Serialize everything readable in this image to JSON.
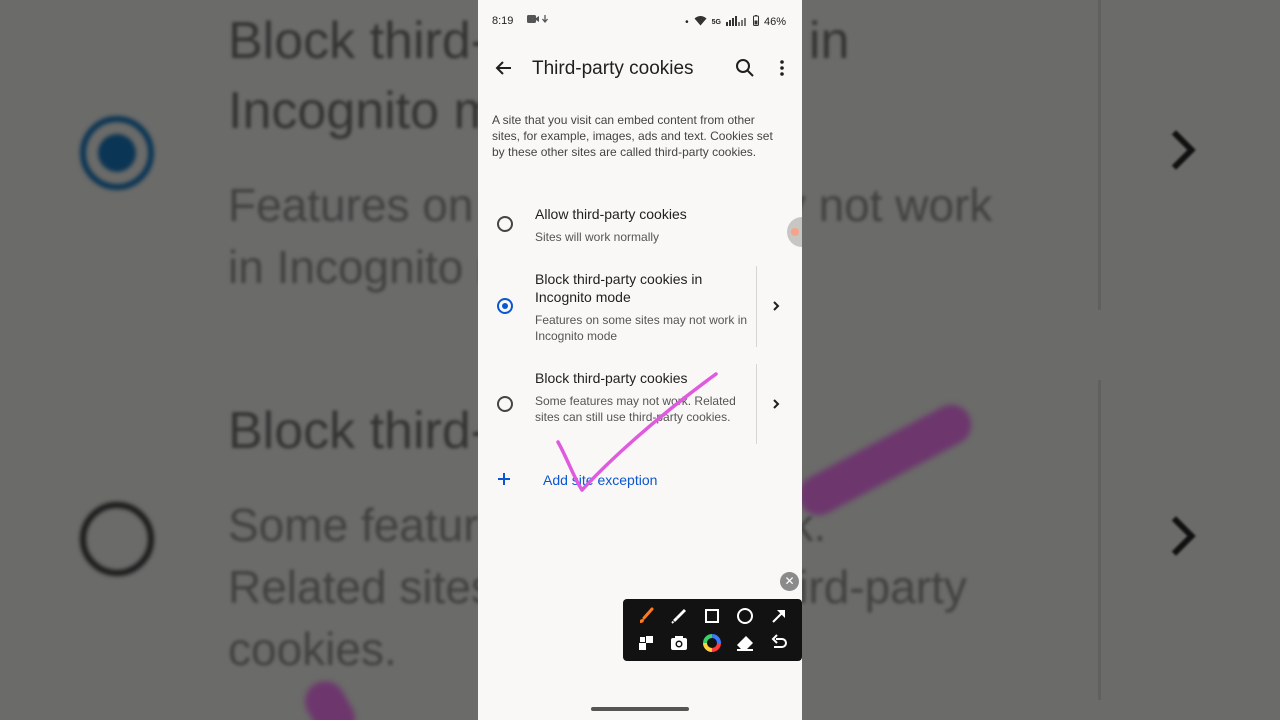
{
  "status_bar": {
    "time": "8:19",
    "indicators": "• ",
    "network": "5G",
    "battery": "46%"
  },
  "app_bar": {
    "title": "Third-party cookies"
  },
  "description": "A site that you visit can embed content from other sites, for example, images, ads and text. Cookies set by these other sites are called third-party cookies.",
  "options": [
    {
      "title": "Allow third-party cookies",
      "subtitle": "Sites will work normally",
      "selected": false
    },
    {
      "title": "Block third-party cookies in Incognito mode",
      "subtitle": "Features on some sites may not work in Incognito mode",
      "selected": true
    },
    {
      "title": "Block third-party cookies",
      "subtitle": "Some features may not work. Related sites can still use third-party cookies.",
      "selected": false
    }
  ],
  "add_exception": {
    "label": "Add site exception"
  },
  "background": {
    "title_line1": "Block third-party cookies in",
    "title_line2": "Incognito mode",
    "sub_line1": "Features on some sites may not work",
    "sub_line2": "in Incognito mode",
    "title2": "Block third-party cookies",
    "sub2_line1": "Some features may not work.",
    "sub2_line2": "Related sites can still use third-party",
    "sub2_line3": "cookies."
  },
  "annotation_toolbar": {
    "tools": [
      "brush-icon",
      "highlighter-icon",
      "rectangle-icon",
      "circle-icon",
      "arrow-icon",
      "mosaic-icon",
      "camera-icon",
      "color-wheel-icon",
      "eraser-icon",
      "undo-icon"
    ]
  },
  "colors": {
    "accent": "#0b57d0",
    "annotation_stroke": "#e05ae0",
    "brush": "#ff7a1a"
  }
}
